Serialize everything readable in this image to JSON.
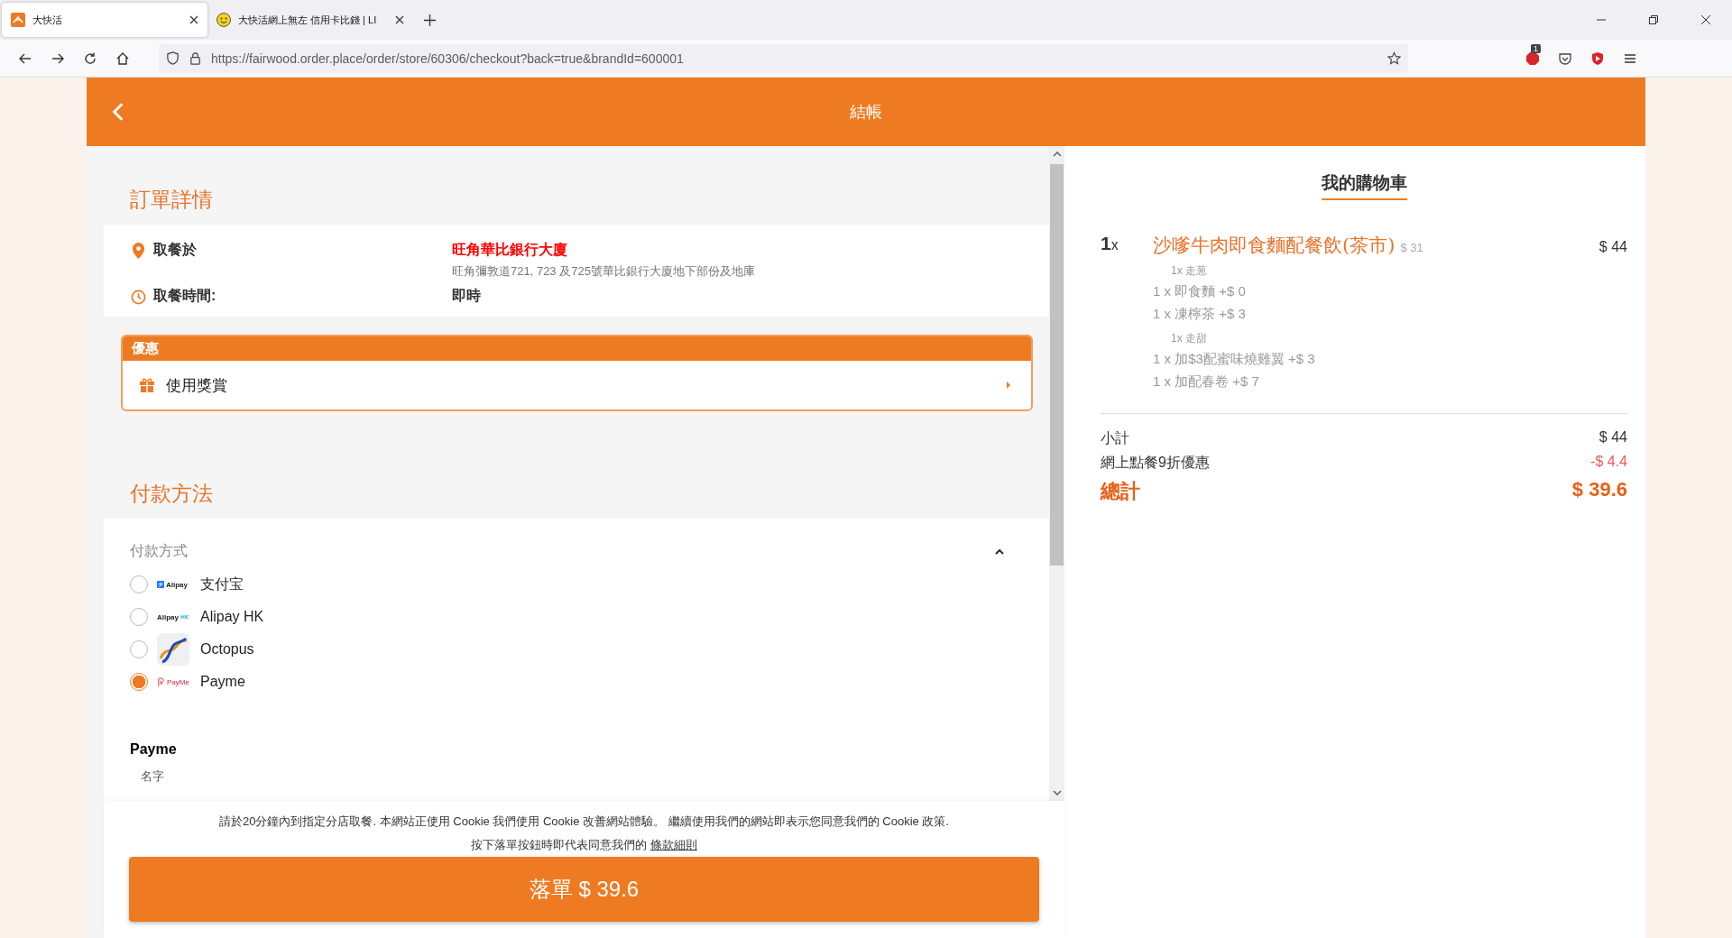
{
  "browser": {
    "tabs": [
      {
        "title": "大快活",
        "selected": true,
        "kind": "brand"
      },
      {
        "title": "大快活網上無左 信用卡比錢 | LI",
        "selected": false,
        "kind": "smiley"
      }
    ],
    "url": "https://fairwood.order.place/order/store/60306/checkout?back=true&brandId=600001",
    "extension_badge": "1"
  },
  "header": {
    "title": "結帳"
  },
  "order_details": {
    "heading": "訂單詳情",
    "pickup_location": {
      "label": "取餐於",
      "name": "旺角華比銀行大廈",
      "address": "旺角彌敦道721, 723 及725號華比銀行大廈地下部份及地庫"
    },
    "pickup_time": {
      "label": "取餐時間:",
      "value": "即時"
    }
  },
  "promo": {
    "heading": "優惠",
    "action": "使用獎賞"
  },
  "payment": {
    "heading": "付款方法",
    "method_label": "付款方式",
    "expanded": true,
    "options": [
      {
        "label": "支付宝",
        "kind": "alipay",
        "logo_text": "Alipay",
        "selected": false
      },
      {
        "label": "Alipay HK",
        "kind": "alipayhk",
        "logo_text": "Alipay",
        "selected": false
      },
      {
        "label": "Octopus",
        "kind": "octopus",
        "selected": false
      },
      {
        "label": "Payme",
        "kind": "payme",
        "logo_text": "PayMe",
        "selected": true
      }
    ],
    "section_title": "Payme",
    "field_label": "名字"
  },
  "footer": {
    "notice": "請於20分鐘內到指定分店取餐. 本網站正使用 Cookie 我們使用 Cookie 改善網站體驗。 繼續使用我們的網站即表示您同意我們的 Cookie 政策.",
    "terms_prefix": "按下落單按鈕時即代表同意我們的",
    "terms_link": "條款細則",
    "place_order": "落單 $ 39.6"
  },
  "cart": {
    "title": "我的購物車",
    "items": [
      {
        "qty": "1",
        "qty_suffix": "x",
        "name": "沙嗲牛肉即食麵配餐飲(茶市)",
        "unit_price": "$ 31",
        "total": "$ 44",
        "options": [
          {
            "kind": "note",
            "text": "1x 走葱"
          },
          {
            "kind": "addon",
            "text": "1 x 即食麵 +$ 0"
          },
          {
            "kind": "addon",
            "text": "1 x 凍檸茶 +$ 3"
          },
          {
            "kind": "note",
            "text": "1x 走甜"
          },
          {
            "kind": "addon",
            "text": "1 x 加$3配蜜味燒雞翼 +$ 3"
          },
          {
            "kind": "addon",
            "text": "1 x 加配春卷 +$ 7"
          }
        ]
      }
    ],
    "subtotal": {
      "label": "小計",
      "value": "$ 44"
    },
    "discount": {
      "label": "網上點餐9折優惠",
      "value": "-$ 4.4"
    },
    "total": {
      "label": "總計",
      "value": "$ 39.6"
    }
  }
}
